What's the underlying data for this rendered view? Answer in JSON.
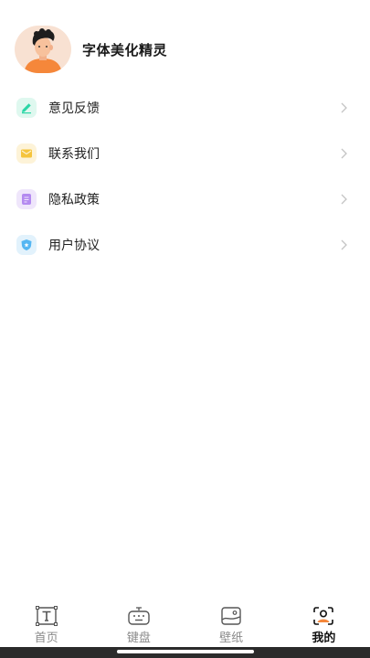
{
  "profile": {
    "app_name": "字体美化精灵",
    "avatar_icon": "person-avatar-icon"
  },
  "menu": {
    "items": [
      {
        "label": "意见反馈",
        "icon": "pencil-icon",
        "color": "#2bd6a6",
        "bg": "#dff8ef"
      },
      {
        "label": "联系我们",
        "icon": "mail-icon",
        "color": "#f5c43c",
        "bg": "#fdf3d8"
      },
      {
        "label": "隐私政策",
        "icon": "document-icon",
        "color": "#b48af0",
        "bg": "#efe6fb"
      },
      {
        "label": "用户协议",
        "icon": "shield-star-icon",
        "color": "#55b6f2",
        "bg": "#e2f2fc"
      }
    ]
  },
  "tabbar": {
    "tabs": [
      {
        "label": "首页",
        "icon": "text-frame-icon",
        "active": false
      },
      {
        "label": "键盘",
        "icon": "keyboard-icon",
        "active": false
      },
      {
        "label": "壁纸",
        "icon": "wallpaper-icon",
        "active": false
      },
      {
        "label": "我的",
        "icon": "profile-icon",
        "active": true
      }
    ]
  },
  "colors": {
    "accent_orange": "#f5873a",
    "text_primary": "#1a1a1a",
    "text_inactive": "#8a8a8a"
  }
}
